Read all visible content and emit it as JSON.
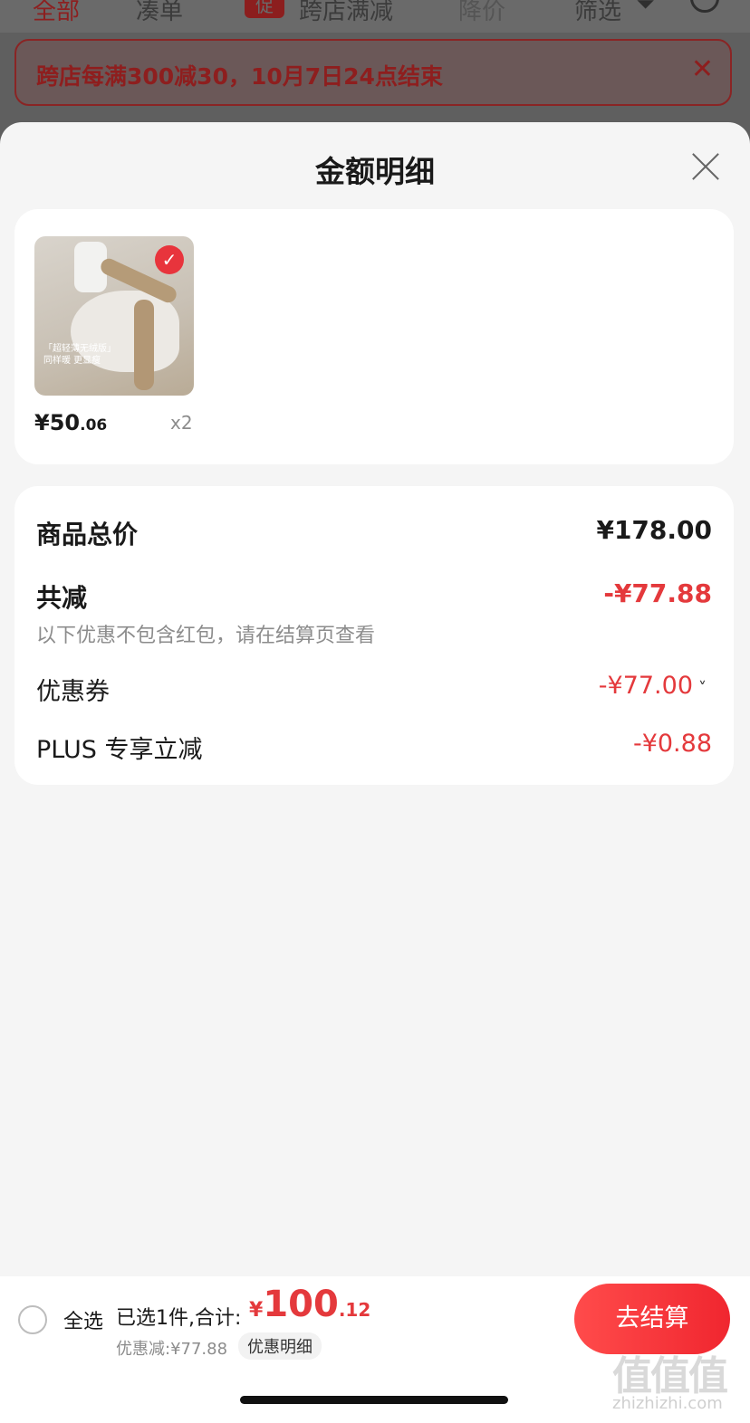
{
  "background": {
    "tabs": [
      "全部",
      "凑单",
      "跨店满减",
      "降价",
      "筛选"
    ],
    "badge": "促",
    "promo": "跨店每满300减30，10月7日24点结束"
  },
  "sheet": {
    "title": "金额明细",
    "product": {
      "price_int": "¥50",
      "price_dec": ".06",
      "qty": "x2",
      "thumb_text_line1": "「超轻薄无绒版」",
      "thumb_text_line2": "同样暖 更显瘦"
    },
    "summary": {
      "total_label": "商品总价",
      "total_value": "¥178.00",
      "discount_label": "共减",
      "discount_value": "-¥77.88",
      "discount_note": "以下优惠不包含红包，请在结算页查看",
      "coupon_label": "优惠券",
      "coupon_value": "-¥77.00",
      "plus_label": "PLUS 专享立减",
      "plus_value": "-¥0.88"
    }
  },
  "bottom": {
    "select_all": "全选",
    "selected_text": "已选1件,合计:",
    "sum_currency": "¥",
    "sum_int": "100",
    "sum_dec": ".12",
    "discount_text": "优惠减:¥77.88",
    "detail_label": "优惠明细",
    "checkout_label": "去结算",
    "watermark": "值值值",
    "watermark_sub": "zhizhizhi.com"
  },
  "colors": {
    "accent": "#e4393c",
    "checkout": "#f0262f"
  }
}
